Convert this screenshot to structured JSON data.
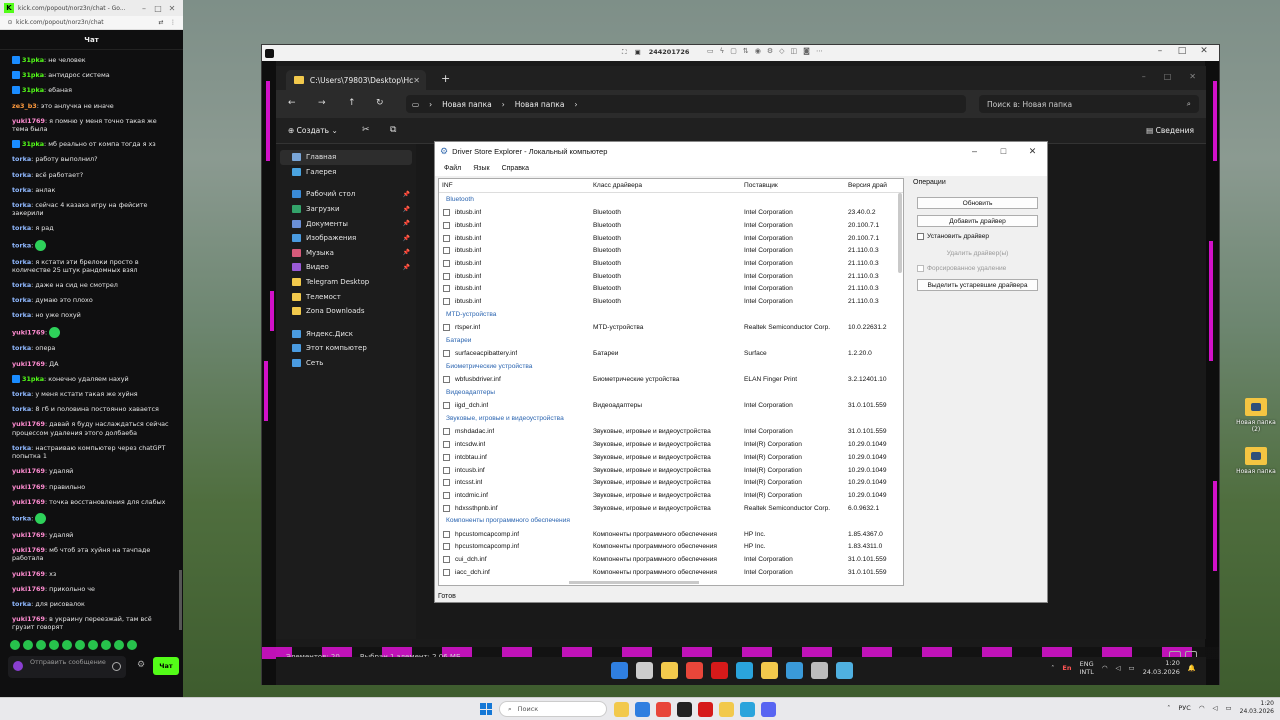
{
  "chat_window": {
    "title": "kick.com/popout/norz3n/chat - Go...",
    "url": "kick.com/popout/norz3n/chat",
    "header": "Чат",
    "messages": [
      {
        "user": "31pka",
        "text": "не человек",
        "color": "c-green",
        "badge": true
      },
      {
        "user": "31pka",
        "text": "антидрос система",
        "color": "c-green",
        "badge": true
      },
      {
        "user": "31pka",
        "text": "ебаная",
        "color": "c-green",
        "badge": true
      },
      {
        "user": "ze3_b3",
        "text": "это анлучка не иначе",
        "color": "c-orange"
      },
      {
        "user": "yuki1769",
        "text": "я помню у меня точно такая же тема была",
        "color": "c-pink"
      },
      {
        "user": "31pka",
        "text": "мб реально от компа тогда я хз",
        "color": "c-green",
        "badge": true
      },
      {
        "user": "torka",
        "text": "работу выполнил?",
        "color": "c-blue"
      },
      {
        "user": "torka",
        "text": "всё работает?",
        "color": "c-blue"
      },
      {
        "user": "torka",
        "text": "анлак",
        "color": "c-blue"
      },
      {
        "user": "torka",
        "text": "сейчас 4 казаха игру на фейсите закерили",
        "color": "c-blue"
      },
      {
        "user": "torka",
        "text": "я рад",
        "color": "c-blue"
      },
      {
        "user": "torka",
        "text": "",
        "color": "c-blue",
        "emote": true
      },
      {
        "user": "torka",
        "text": "я кстати эти брелоки просто в количестве 25 штук рандомных взял",
        "color": "c-blue"
      },
      {
        "user": "torka",
        "text": "даже на сид не смотрел",
        "color": "c-blue"
      },
      {
        "user": "torka",
        "text": "думаю это плохо",
        "color": "c-blue"
      },
      {
        "user": "torka",
        "text": "но уже похуй",
        "color": "c-blue"
      },
      {
        "user": "yuki1769",
        "text": "",
        "color": "c-pink",
        "emote": true
      },
      {
        "user": "torka",
        "text": "опера",
        "color": "c-blue"
      },
      {
        "user": "yuki1769",
        "text": "ДА",
        "color": "c-pink"
      },
      {
        "user": "31pka",
        "text": "конечно удаляем нахуй",
        "color": "c-green",
        "badge": true
      },
      {
        "user": "torka",
        "text": "у меня кстати такая же хуйня",
        "color": "c-blue"
      },
      {
        "user": "torka",
        "text": "8 гб и половина постоянно хавается",
        "color": "c-blue"
      },
      {
        "user": "yuki1769",
        "text": "давай я буду наслаждаться сейчас процессом удаления этого долбаеба",
        "color": "c-pink"
      },
      {
        "user": "torka",
        "text": "настраиваю компьютер через chatGPT попытка 1",
        "color": "c-blue"
      },
      {
        "user": "yuki1769",
        "text": "удаляй",
        "color": "c-pink"
      },
      {
        "user": "yuki1769",
        "text": "правильно",
        "color": "c-pink"
      },
      {
        "user": "yuki1769",
        "text": "точка восстановления для слабых",
        "color": "c-pink"
      },
      {
        "user": "torka",
        "text": "",
        "color": "c-blue",
        "emote": true
      },
      {
        "user": "yuki1769",
        "text": "удаляй",
        "color": "c-pink"
      },
      {
        "user": "yuki1769",
        "text": "мб чтоб эта хуйня на тачпаде работала",
        "color": "c-pink"
      },
      {
        "user": "yuki1769",
        "text": "хз",
        "color": "c-pink"
      },
      {
        "user": "yuki1769",
        "text": "прикольно че",
        "color": "c-pink"
      },
      {
        "user": "torka",
        "text": "для рисовалок",
        "color": "c-blue"
      },
      {
        "user": "yuki1769",
        "text": "в украину переезжай, там всё грузит говорят",
        "color": "c-pink"
      }
    ],
    "input_placeholder": "Отправить сообщение",
    "send_label": "Чат"
  },
  "remote_viewer": {
    "session_id": "244201726"
  },
  "explorer": {
    "tab_title": "C:\\Users\\79803\\Desktop\\Нс",
    "path": [
      "Новая папка",
      "Новая папка"
    ],
    "search_placeholder": "Поиск в: Новая папка",
    "create_label": "Создать",
    "details_label": "Сведения",
    "sidebar": [
      {
        "label": "Главная",
        "color": "#7aa6d8",
        "active": true
      },
      {
        "label": "Галерея",
        "color": "#4aa3df"
      },
      {
        "gap": true
      },
      {
        "label": "Рабочий стол",
        "color": "#3a8ad6",
        "pin": true
      },
      {
        "label": "Загрузки",
        "color": "#33a36a",
        "pin": true
      },
      {
        "label": "Документы",
        "color": "#6b8fd6",
        "pin": true
      },
      {
        "label": "Изображения",
        "color": "#4a9be0",
        "pin": true
      },
      {
        "label": "Музыка",
        "color": "#d65a7a",
        "pin": true
      },
      {
        "label": "Видео",
        "color": "#9a5ad6",
        "pin": true
      },
      {
        "label": "Telegram Desktop",
        "color": "#f2c94c"
      },
      {
        "label": "Телемост",
        "color": "#f2c94c"
      },
      {
        "label": "Zona Downloads",
        "color": "#f2c94c"
      },
      {
        "gap": true
      },
      {
        "label": "Яндекс.Диск",
        "color": "#4a9be0"
      },
      {
        "label": "Этот компьютер",
        "color": "#4a9be0"
      },
      {
        "label": "Сеть",
        "color": "#4a9be0"
      }
    ],
    "status_count": "Элементов: 20",
    "status_selected": "Выбран 1 элемент: 2,06 МБ"
  },
  "driver_store": {
    "title": "Driver Store Explorer - Локальный компьютер",
    "menu": [
      "Файл",
      "Язык",
      "Справка"
    ],
    "columns": [
      "INF",
      "Класс драйвера",
      "Поставщик",
      "Версия драй"
    ],
    "groups": [
      {
        "name": "Bluetooth",
        "rows": [
          [
            "ibtusb.inf",
            "Bluetooth",
            "Intel Corporation",
            "23.40.0.2"
          ],
          [
            "ibtusb.inf",
            "Bluetooth",
            "Intel Corporation",
            "20.100.7.1"
          ],
          [
            "ibtusb.inf",
            "Bluetooth",
            "Intel Corporation",
            "20.100.7.1"
          ],
          [
            "ibtusb.inf",
            "Bluetooth",
            "Intel Corporation",
            "21.110.0.3"
          ],
          [
            "ibtusb.inf",
            "Bluetooth",
            "Intel Corporation",
            "21.110.0.3"
          ],
          [
            "ibtusb.inf",
            "Bluetooth",
            "Intel Corporation",
            "21.110.0.3"
          ],
          [
            "ibtusb.inf",
            "Bluetooth",
            "Intel Corporation",
            "21.110.0.3"
          ],
          [
            "ibtusb.inf",
            "Bluetooth",
            "Intel Corporation",
            "21.110.0.3"
          ]
        ]
      },
      {
        "name": "MTD-устройства",
        "rows": [
          [
            "rtsper.inf",
            "MTD-устройства",
            "Realtek Semiconductor Corp.",
            "10.0.22631.2"
          ]
        ]
      },
      {
        "name": "Батареи",
        "rows": [
          [
            "surfaceacpibattery.inf",
            "Батареи",
            "Surface",
            "1.2.20.0"
          ]
        ]
      },
      {
        "name": "Биометрические устройства",
        "rows": [
          [
            "wbfusbdriver.inf",
            "Биометрические устройства",
            "ELAN Finger Print",
            "3.2.12401.10"
          ]
        ]
      },
      {
        "name": "Видеоадаптеры",
        "rows": [
          [
            "iigd_dch.inf",
            "Видеоадаптеры",
            "Intel Corporation",
            "31.0.101.559"
          ]
        ]
      },
      {
        "name": "Звуковые, игровые и видеоустройства",
        "rows": [
          [
            "mshdadac.inf",
            "Звуковые, игровые и видеоустройства",
            "Intel Corporation",
            "31.0.101.559"
          ],
          [
            "intcsdw.inf",
            "Звуковые, игровые и видеоустройства",
            "Intel(R) Corporation",
            "10.29.0.1049"
          ],
          [
            "intcbtau.inf",
            "Звуковые, игровые и видеоустройства",
            "Intel(R) Corporation",
            "10.29.0.1049"
          ],
          [
            "intcusb.inf",
            "Звуковые, игровые и видеоустройства",
            "Intel(R) Corporation",
            "10.29.0.1049"
          ],
          [
            "intcsst.inf",
            "Звуковые, игровые и видеоустройства",
            "Intel(R) Corporation",
            "10.29.0.1049"
          ],
          [
            "intcdmic.inf",
            "Звуковые, игровые и видеоустройства",
            "Intel(R) Corporation",
            "10.29.0.1049"
          ],
          [
            "hdxssthpnb.inf",
            "Звуковые, игровые и видеоустройства",
            "Realtek Semiconductor Corp.",
            "6.0.9632.1"
          ]
        ]
      },
      {
        "name": "Компоненты программного обеспечения",
        "rows": [
          [
            "hpcustomcapcomp.inf",
            "Компоненты программного обеспечения",
            "HP Inc.",
            "1.85.4367.0"
          ],
          [
            "hpcustomcapcomp.inf",
            "Компоненты программного обеспечения",
            "HP Inc.",
            "1.83.4311.0"
          ],
          [
            "cui_dch.inf",
            "Компоненты программного обеспечения",
            "Intel Corporation",
            "31.0.101.559"
          ],
          [
            "iacc_dch.inf",
            "Компоненты программного обеспечения",
            "Intel Corporation",
            "31.0.101.559"
          ]
        ]
      }
    ],
    "ops_title": "Операции",
    "btn_refresh": "Обновить",
    "btn_add": "Добавить драйвер",
    "chk_install": "Установить драйвер",
    "btn_delete": "Удалить драйвер(ы)",
    "chk_force": "Форсированное удаление",
    "btn_select_old": "Выделить устаревшие драйвера",
    "status": "Готов"
  },
  "remote_taskbar": {
    "lang_top": "ENG",
    "lang_bottom": "INTL",
    "en_badge": "En",
    "time": "1:20",
    "date": "24.03.2026",
    "icon_colors": [
      "#2f7fe0",
      "#cccccc",
      "#f2c94c",
      "#e8463a",
      "#d61a1a",
      "#2aa4dc",
      "#f2c94c",
      "#3a9ad9",
      "#bbbbbb",
      "#4fb0e0"
    ]
  },
  "desktop_icons": [
    "Новая папка (2)",
    "Новая папка"
  ],
  "host_taskbar": {
    "search_label": "Поиск",
    "lang": "РУС",
    "time": "1:20",
    "date": "24.03.2026",
    "icon_colors": [
      "#f2c94c",
      "#2f7fe0",
      "#e8463a",
      "#222222",
      "#d61a1a",
      "#f2c94c",
      "#2aa4dc",
      "#5865f2"
    ]
  }
}
